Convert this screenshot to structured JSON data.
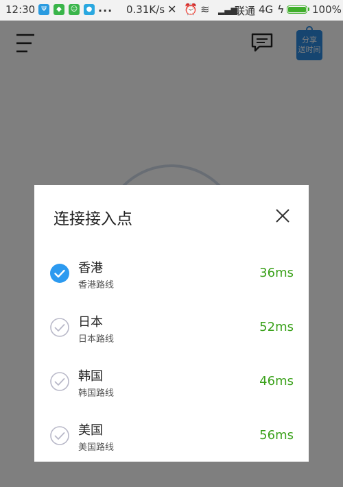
{
  "status_bar": {
    "time": "12:30",
    "network_speed": "0.31K/s",
    "carrier": "联通",
    "network_type": "4G",
    "battery": "100%",
    "battery_level": 1.0,
    "more_indicator": "..."
  },
  "header": {
    "menu_icon": "hamburger-menu-icon",
    "chat_icon": "message-icon",
    "share_badge": {
      "line1": "分享",
      "line2": "送时间"
    }
  },
  "dialog": {
    "title": "连接接入点",
    "close_icon": "close-icon",
    "items": [
      {
        "name": "香港",
        "subtitle": "香港路线",
        "latency": "36ms",
        "selected": true
      },
      {
        "name": "日本",
        "subtitle": "日本路线",
        "latency": "52ms",
        "selected": false
      },
      {
        "name": "韩国",
        "subtitle": "韩国路线",
        "latency": "46ms",
        "selected": false
      },
      {
        "name": "美国",
        "subtitle": "美国路线",
        "latency": "56ms",
        "selected": false
      }
    ]
  },
  "colors": {
    "accent": "#2c8ae0",
    "latency": "#3aa11a",
    "selected_check": "#2c9af0",
    "unselected_check": "#b8b8c8",
    "battery": "#3fae2a"
  }
}
